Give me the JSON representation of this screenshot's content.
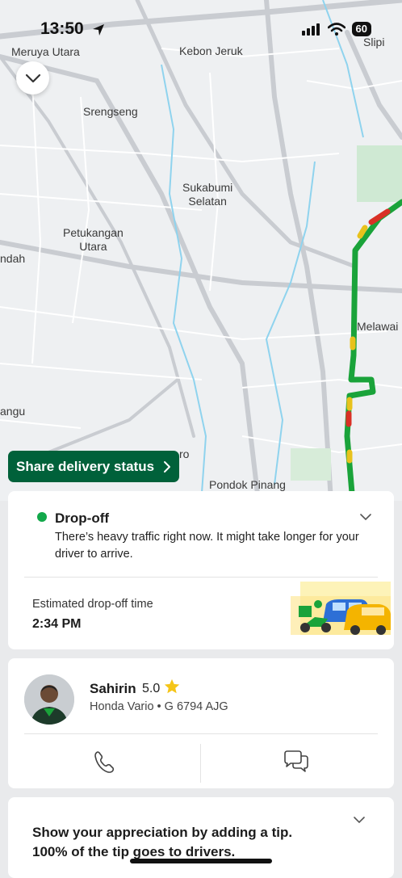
{
  "status_bar": {
    "time": "13:50",
    "battery": "60",
    "icons": [
      "location-arrow-icon",
      "cellular-signal-icon",
      "wifi-icon",
      "battery-icon"
    ]
  },
  "map": {
    "labels": [
      "Meruya Utara",
      "Kebon Jeruk",
      "Slipi",
      "Srengseng",
      "Sukabumi\nSelatan",
      "Petukangan\nUtara",
      "ndah",
      "Melawai",
      "angu",
      "ro",
      "Pondok Pinang"
    ],
    "route_color": "#1aa33a",
    "traffic_colors": [
      "#e8c21c",
      "#d93025"
    ]
  },
  "share_button": {
    "label": "Share delivery status",
    "icon": "chevron-right-icon"
  },
  "dropoff": {
    "title": "Drop-off",
    "message": "There’s heavy traffic right now. It might take longer for your driver to arrive.",
    "eta_label": "Estimated drop-off time",
    "eta_time": "2:34 PM",
    "status_color": "#12a84a"
  },
  "driver": {
    "name": "Sahirin",
    "rating": "5.0",
    "vehicle": "Honda Vario",
    "plate": "G 6794 AJG",
    "vehicle_line": "Honda Vario • G 6794 AJG",
    "actions": [
      "phone-icon",
      "chat-icon"
    ]
  },
  "tip": {
    "text": "Show your appreciation by adding a tip. 100% of the tip goes to drivers."
  },
  "colors": {
    "brand_green": "#00613a",
    "star": "#f5c518"
  }
}
